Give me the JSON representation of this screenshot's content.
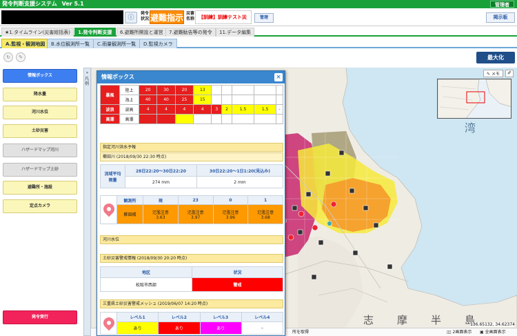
{
  "app": {
    "title": "発令判断支援システム",
    "version": "Ver 5.1",
    "user_badge": "管理者"
  },
  "header": {
    "status_label": "発令\n状況",
    "order_status": "避難指示",
    "disaster_label": "災害\n名称",
    "disaster_name": "【訓練】訓練テスト災害",
    "admin_button": "管理",
    "bulletin_button": "掲示板"
  },
  "main_tabs": [
    {
      "label": "★1.タイムライン(災害総括表)",
      "active": false
    },
    {
      "label": "1.発令判断支援",
      "active": true
    },
    {
      "label": "6.避難所開設と運営",
      "active": false
    },
    {
      "label": "7.避難勧告等の発令",
      "active": false
    },
    {
      "label": "11.データ編集",
      "active": false
    }
  ],
  "sub_tabs": [
    {
      "label": "A.監視・観測地図",
      "active": true
    },
    {
      "label": "B.水位観測所一覧",
      "active": false
    },
    {
      "label": "C.雨量観測所一覧",
      "active": false
    },
    {
      "label": "D.監視カメラ",
      "active": false
    }
  ],
  "toolbar": {
    "maximize_label": "最大化"
  },
  "sidebar": {
    "items": [
      {
        "label": "情報ボックス",
        "style": "info"
      },
      {
        "label": "降水量",
        "style": "yel"
      },
      {
        "label": "河川水位",
        "style": "yel"
      },
      {
        "label": "土砂災害",
        "style": "yel"
      },
      {
        "label": "ハザードマップ河川",
        "style": "gray"
      },
      {
        "label": "ハザードマップ土砂",
        "style": "gray"
      },
      {
        "label": "避難所・施設",
        "style": "yel"
      },
      {
        "label": "定点カメラ",
        "style": "yel"
      }
    ],
    "issue_button": "発令実行"
  },
  "collapse": {
    "label": "凡例"
  },
  "map": {
    "memo_label": "メモ",
    "bay_label": "湾",
    "place_labels": [
      "志",
      "摩",
      "半",
      "島"
    ],
    "coords": "136.65132, 34.62374",
    "bottom_left": "所を取得",
    "two_screen": "2画面表示",
    "full_screen": "全画面表示"
  },
  "panel": {
    "title": "情報ボックス",
    "weather": {
      "rows": [
        {
          "group": "暴風",
          "name": "陸上",
          "cells": [
            "20",
            "30",
            "20",
            "13",
            "",
            "",
            "",
            "",
            ""
          ]
        },
        {
          "group": "",
          "name": "海上",
          "cells": [
            "40",
            "40",
            "25",
            "15",
            "",
            "",
            "",
            "",
            ""
          ]
        },
        {
          "group": "波浪",
          "name": "波高",
          "cells": [
            "4",
            "4",
            "4",
            "4",
            "3",
            "2",
            "1.5",
            "1.5",
            "-"
          ]
        },
        {
          "group": "高潮",
          "name": "高潮",
          "cells": [
            "",
            "",
            "",
            "",
            "",
            "",
            "",
            "",
            ""
          ]
        }
      ]
    },
    "flood_title": "指定河川洪水予報",
    "flood_river": "櫛田川 (2018/09/30 22:30 時点)",
    "rain": {
      "label": "流域平均\n雨量",
      "col1": "28日22:20〜30日22:20",
      "col2": "30日22:20〜1日1:20(見込み)",
      "val1": "274 mm",
      "val2": "2 mm"
    },
    "station": {
      "headers": [
        "観測所",
        "現",
        "23",
        "0",
        "1"
      ],
      "name": "櫛田橋",
      "values": [
        "氾濫注意\n3.63",
        "氾濫注意\n3.97",
        "氾濫注意\n3.96",
        "氾濫注意\n3.68"
      ]
    },
    "river_title": "河川水位",
    "landslide_title": "土砂災害警戒情報 (2018/09/30 20:20 時点)",
    "landslide": {
      "headers": [
        "地区",
        "状況"
      ],
      "area": "松阪市西部",
      "status": "警戒"
    },
    "mesh_title": "三重県土砂災害警戒メッシュ (2019/06/07 14:20 時点)",
    "mesh": {
      "headers": [
        "レベル1",
        "レベル2",
        "レベル3",
        "レベル4"
      ],
      "values": [
        "あり",
        "あり",
        "あり",
        "–"
      ]
    }
  },
  "colors": {
    "green": "#1aa13a",
    "order": "#ff8c00",
    "panel_header": "#3a87cf",
    "warning_red": "#ff0000",
    "caution_orange": "#ff9900"
  }
}
